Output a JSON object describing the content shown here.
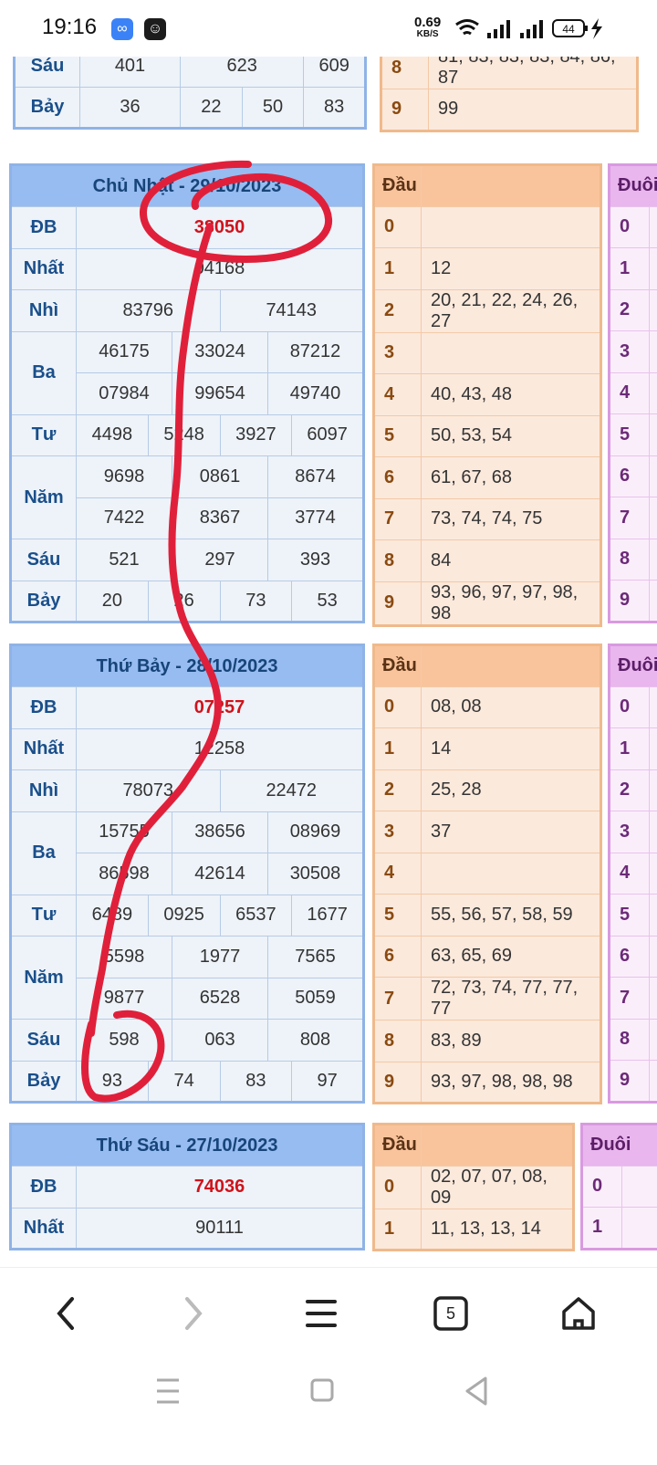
{
  "status": {
    "time": "19:16",
    "net_speed": "0.69",
    "net_unit": "KB/S",
    "battery": "44",
    "colors": {
      "app1": "#3b82f6",
      "app2": "#1c1c1c"
    }
  },
  "top_partial": {
    "rows": [
      {
        "label": "Sáu",
        "values": [
          "401",
          "623",
          "609"
        ]
      },
      {
        "label": "Bảy",
        "values": [
          "36",
          "22",
          "50",
          "83"
        ]
      }
    ],
    "dau_rows": [
      {
        "n": "8",
        "v": "81, 83, 83, 83, 84, 86, 87"
      },
      {
        "n": "9",
        "v": "99"
      }
    ]
  },
  "draws": [
    {
      "title": "Chủ Nhật - 29/10/2023",
      "db": "38050",
      "nhat": "04168",
      "nhi": [
        "83796",
        "74143"
      ],
      "ba": [
        [
          "46175",
          "33024",
          "87212"
        ],
        [
          "07984",
          "99654",
          "49740"
        ]
      ],
      "tu": [
        "4498",
        "5248",
        "3927",
        "6097"
      ],
      "nam": [
        [
          "9698",
          "0861",
          "8674"
        ],
        [
          "7422",
          "8367",
          "3774"
        ]
      ],
      "sau": [
        "521",
        "297",
        "393"
      ],
      "bay": [
        "20",
        "26",
        "73",
        "53"
      ],
      "dau": [
        "",
        "12",
        "20, 21, 22, 24, 26, 27",
        "",
        "40, 43, 48",
        "50, 53, 54",
        "61, 67, 68",
        "73, 74, 74, 75",
        "84",
        "93, 96, 97, 97, 98, 98"
      ],
      "duoi_header": "Đuôi"
    },
    {
      "title": "Thứ Bảy - 28/10/2023",
      "db": "07257",
      "nhat": "12258",
      "nhi": [
        "78073",
        "22472"
      ],
      "ba": [
        [
          "15755",
          "38656",
          "08969"
        ],
        [
          "86598",
          "42614",
          "30508"
        ]
      ],
      "tu": [
        "6489",
        "0925",
        "6537",
        "1677"
      ],
      "nam": [
        [
          "5598",
          "1977",
          "7565"
        ],
        [
          "9877",
          "6528",
          "5059"
        ]
      ],
      "sau": [
        "598",
        "063",
        "808"
      ],
      "bay": [
        "93",
        "74",
        "83",
        "97"
      ],
      "dau": [
        "08, 08",
        "14",
        "25, 28",
        "37",
        "",
        "55, 56, 57, 58, 59",
        "63, 65, 69",
        "72, 73, 74, 77, 77, 77",
        "83, 89",
        "93, 97, 98, 98, 98"
      ],
      "duoi_header": "Đuôi"
    },
    {
      "title": "Thứ Sáu - 27/10/2023",
      "db": "74036",
      "nhat": "90111",
      "dau": [
        "02, 07, 07, 08, 09",
        "11, 13, 13, 14"
      ],
      "duoi_header": "Đuôi"
    }
  ],
  "labels": {
    "db": "ĐB",
    "nhat": "Nhất",
    "nhi": "Nhì",
    "ba": "Ba",
    "tu": "Tư",
    "nam": "Năm",
    "sau": "Sáu",
    "bay": "Bảy",
    "dau": "Đầu"
  },
  "nav": {
    "tab_count": "5"
  },
  "annotation_color": "#e0203a"
}
